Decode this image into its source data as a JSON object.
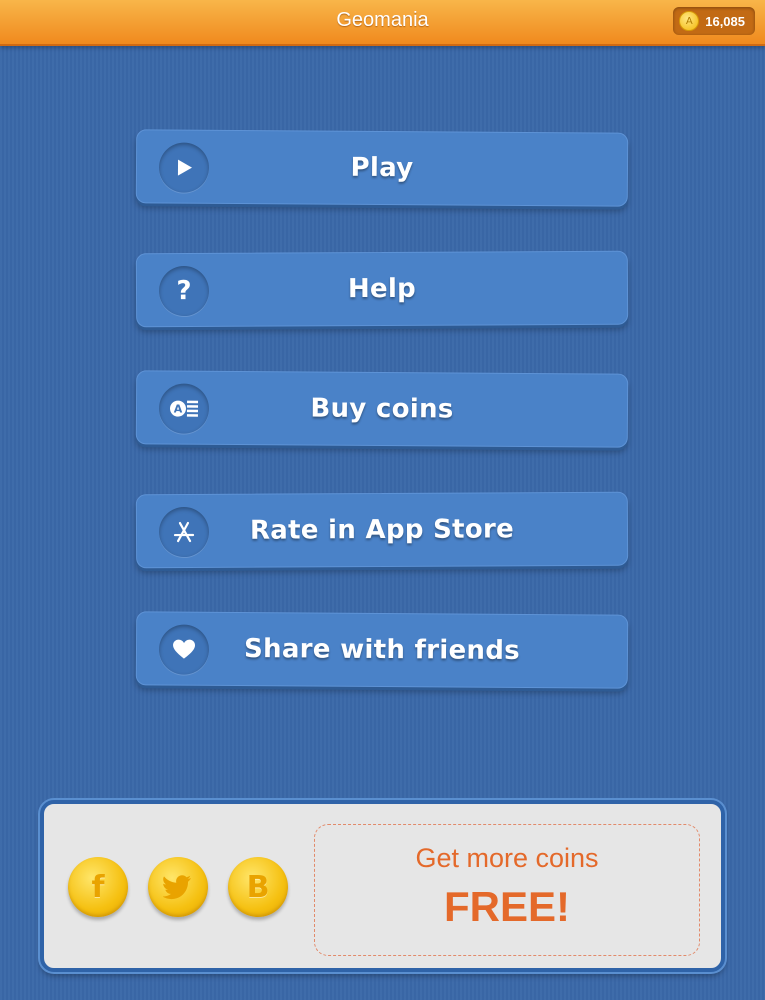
{
  "header": {
    "title": "Geomania",
    "coins": "16,085",
    "coin_icon": "coin-icon"
  },
  "menu": {
    "items": [
      {
        "label": "Play",
        "icon": "play-icon"
      },
      {
        "label": "Help",
        "icon": "question-icon"
      },
      {
        "label": "Buy coins",
        "icon": "coin-stack-icon"
      },
      {
        "label": "Rate in App Store",
        "icon": "app-store-icon"
      },
      {
        "label": "Share with friends",
        "icon": "heart-icon"
      }
    ]
  },
  "promo": {
    "line1": "Get more coins",
    "line2": "FREE!",
    "social": [
      {
        "icon": "facebook-icon",
        "glyph": "f"
      },
      {
        "icon": "twitter-icon",
        "glyph": ""
      },
      {
        "icon": "blog-icon",
        "glyph": "B"
      }
    ]
  },
  "colors": {
    "background": "#3a68a8",
    "header": "#f08a1e",
    "button": "#4a82c8",
    "promo_text": "#e4692a",
    "coin_gold": "#f5c010"
  }
}
